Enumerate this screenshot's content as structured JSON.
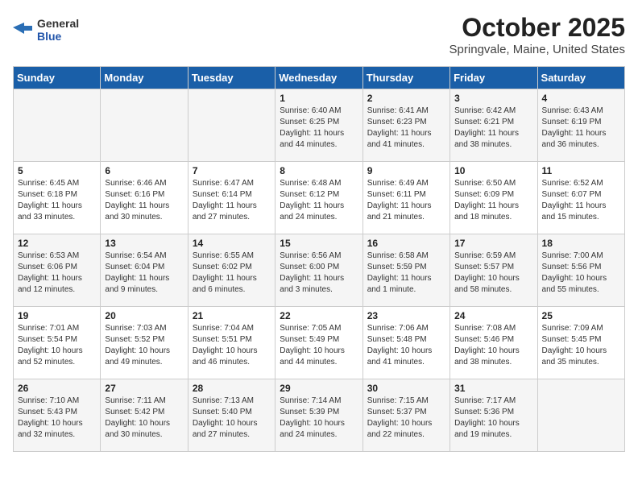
{
  "header": {
    "logo_general": "General",
    "logo_blue": "Blue",
    "title": "October 2025",
    "subtitle": "Springvale, Maine, United States"
  },
  "weekdays": [
    "Sunday",
    "Monday",
    "Tuesday",
    "Wednesday",
    "Thursday",
    "Friday",
    "Saturday"
  ],
  "weeks": [
    [
      {
        "day": "",
        "info": ""
      },
      {
        "day": "",
        "info": ""
      },
      {
        "day": "",
        "info": ""
      },
      {
        "day": "1",
        "info": "Sunrise: 6:40 AM\nSunset: 6:25 PM\nDaylight: 11 hours\nand 44 minutes."
      },
      {
        "day": "2",
        "info": "Sunrise: 6:41 AM\nSunset: 6:23 PM\nDaylight: 11 hours\nand 41 minutes."
      },
      {
        "day": "3",
        "info": "Sunrise: 6:42 AM\nSunset: 6:21 PM\nDaylight: 11 hours\nand 38 minutes."
      },
      {
        "day": "4",
        "info": "Sunrise: 6:43 AM\nSunset: 6:19 PM\nDaylight: 11 hours\nand 36 minutes."
      }
    ],
    [
      {
        "day": "5",
        "info": "Sunrise: 6:45 AM\nSunset: 6:18 PM\nDaylight: 11 hours\nand 33 minutes."
      },
      {
        "day": "6",
        "info": "Sunrise: 6:46 AM\nSunset: 6:16 PM\nDaylight: 11 hours\nand 30 minutes."
      },
      {
        "day": "7",
        "info": "Sunrise: 6:47 AM\nSunset: 6:14 PM\nDaylight: 11 hours\nand 27 minutes."
      },
      {
        "day": "8",
        "info": "Sunrise: 6:48 AM\nSunset: 6:12 PM\nDaylight: 11 hours\nand 24 minutes."
      },
      {
        "day": "9",
        "info": "Sunrise: 6:49 AM\nSunset: 6:11 PM\nDaylight: 11 hours\nand 21 minutes."
      },
      {
        "day": "10",
        "info": "Sunrise: 6:50 AM\nSunset: 6:09 PM\nDaylight: 11 hours\nand 18 minutes."
      },
      {
        "day": "11",
        "info": "Sunrise: 6:52 AM\nSunset: 6:07 PM\nDaylight: 11 hours\nand 15 minutes."
      }
    ],
    [
      {
        "day": "12",
        "info": "Sunrise: 6:53 AM\nSunset: 6:06 PM\nDaylight: 11 hours\nand 12 minutes."
      },
      {
        "day": "13",
        "info": "Sunrise: 6:54 AM\nSunset: 6:04 PM\nDaylight: 11 hours\nand 9 minutes."
      },
      {
        "day": "14",
        "info": "Sunrise: 6:55 AM\nSunset: 6:02 PM\nDaylight: 11 hours\nand 6 minutes."
      },
      {
        "day": "15",
        "info": "Sunrise: 6:56 AM\nSunset: 6:00 PM\nDaylight: 11 hours\nand 3 minutes."
      },
      {
        "day": "16",
        "info": "Sunrise: 6:58 AM\nSunset: 5:59 PM\nDaylight: 11 hours\nand 1 minute."
      },
      {
        "day": "17",
        "info": "Sunrise: 6:59 AM\nSunset: 5:57 PM\nDaylight: 10 hours\nand 58 minutes."
      },
      {
        "day": "18",
        "info": "Sunrise: 7:00 AM\nSunset: 5:56 PM\nDaylight: 10 hours\nand 55 minutes."
      }
    ],
    [
      {
        "day": "19",
        "info": "Sunrise: 7:01 AM\nSunset: 5:54 PM\nDaylight: 10 hours\nand 52 minutes."
      },
      {
        "day": "20",
        "info": "Sunrise: 7:03 AM\nSunset: 5:52 PM\nDaylight: 10 hours\nand 49 minutes."
      },
      {
        "day": "21",
        "info": "Sunrise: 7:04 AM\nSunset: 5:51 PM\nDaylight: 10 hours\nand 46 minutes."
      },
      {
        "day": "22",
        "info": "Sunrise: 7:05 AM\nSunset: 5:49 PM\nDaylight: 10 hours\nand 44 minutes."
      },
      {
        "day": "23",
        "info": "Sunrise: 7:06 AM\nSunset: 5:48 PM\nDaylight: 10 hours\nand 41 minutes."
      },
      {
        "day": "24",
        "info": "Sunrise: 7:08 AM\nSunset: 5:46 PM\nDaylight: 10 hours\nand 38 minutes."
      },
      {
        "day": "25",
        "info": "Sunrise: 7:09 AM\nSunset: 5:45 PM\nDaylight: 10 hours\nand 35 minutes."
      }
    ],
    [
      {
        "day": "26",
        "info": "Sunrise: 7:10 AM\nSunset: 5:43 PM\nDaylight: 10 hours\nand 32 minutes."
      },
      {
        "day": "27",
        "info": "Sunrise: 7:11 AM\nSunset: 5:42 PM\nDaylight: 10 hours\nand 30 minutes."
      },
      {
        "day": "28",
        "info": "Sunrise: 7:13 AM\nSunset: 5:40 PM\nDaylight: 10 hours\nand 27 minutes."
      },
      {
        "day": "29",
        "info": "Sunrise: 7:14 AM\nSunset: 5:39 PM\nDaylight: 10 hours\nand 24 minutes."
      },
      {
        "day": "30",
        "info": "Sunrise: 7:15 AM\nSunset: 5:37 PM\nDaylight: 10 hours\nand 22 minutes."
      },
      {
        "day": "31",
        "info": "Sunrise: 7:17 AM\nSunset: 5:36 PM\nDaylight: 10 hours\nand 19 minutes."
      },
      {
        "day": "",
        "info": ""
      }
    ]
  ]
}
